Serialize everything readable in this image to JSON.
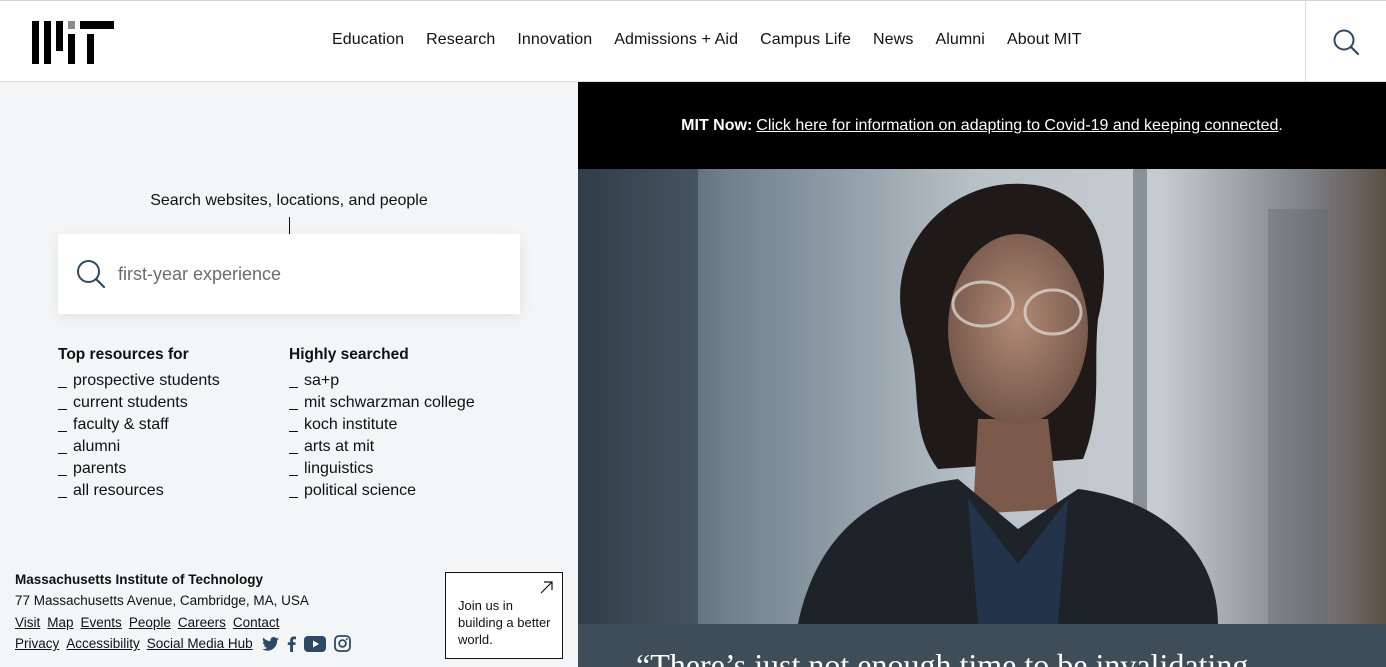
{
  "header": {
    "nav": [
      "Education",
      "Research",
      "Innovation",
      "Admissions + Aid",
      "Campus Life",
      "News",
      "Alumni",
      "About MIT"
    ]
  },
  "search": {
    "label": "Search websites, locations, and people",
    "placeholder": "first-year experience"
  },
  "resources": {
    "top": {
      "title": "Top resources for",
      "items": [
        "prospective students",
        "current students",
        "faculty & staff",
        "alumni",
        "parents",
        "all resources"
      ]
    },
    "highly": {
      "title": "Highly searched",
      "items": [
        "sa+p",
        "mit schwarzman college",
        "koch institute",
        "arts at mit",
        "linguistics",
        "political science"
      ]
    }
  },
  "footer": {
    "org": "Massachusetts Institute of Technology",
    "address": "77 Massachusetts Avenue, Cambridge, MA, USA",
    "links1": [
      "Visit",
      "Map",
      "Events",
      "People",
      "Careers",
      "Contact"
    ],
    "links2": [
      "Privacy",
      "Accessibility",
      "Social Media Hub"
    ],
    "social": [
      "twitter-icon",
      "facebook-icon",
      "youtube-icon",
      "instagram-icon"
    ],
    "join": "Join us in building a better world."
  },
  "alert": {
    "prefix": "MIT Now:",
    "link": "Click here for information on adapting to Covid-19 and keeping connected",
    "suffix": "."
  },
  "hero": {
    "quote": "“There’s just not enough time to be invalidating"
  },
  "colors": {
    "panel_bg": "#f4f5f6",
    "alert_bg": "#000000",
    "quote_bg": "#3f4d59"
  }
}
